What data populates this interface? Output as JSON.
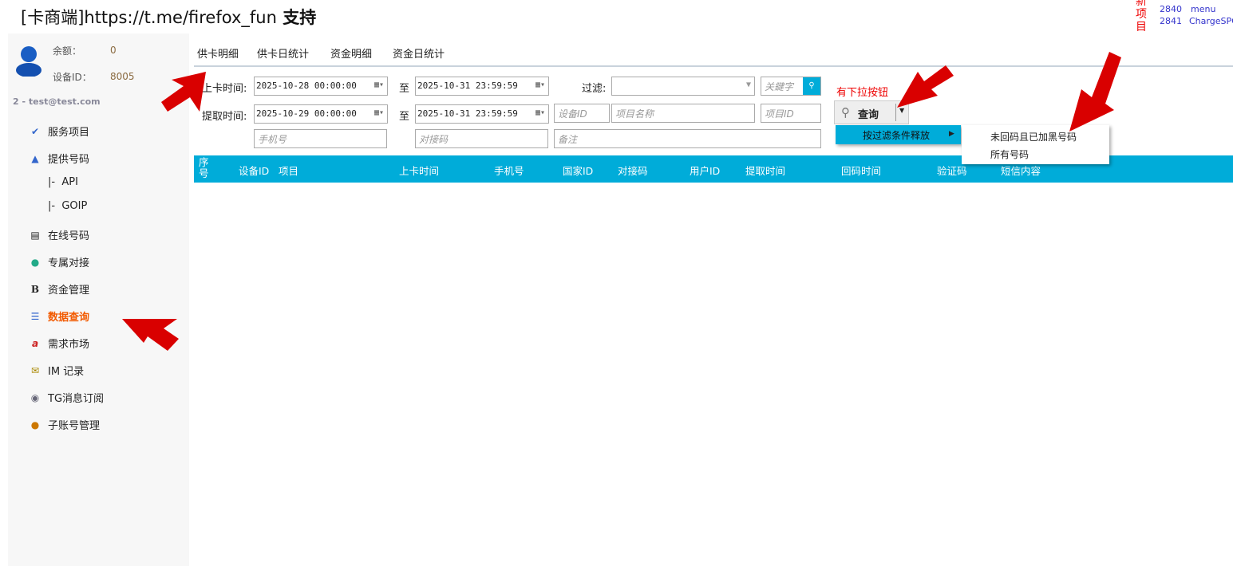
{
  "header": {
    "title_prefix": "[卡商端]",
    "title_url": "https://t.me/firefox_fun",
    "title_suffix": " 支持"
  },
  "new_projects": {
    "label": "新项目",
    "items": [
      {
        "id": "2840",
        "name": "menu"
      },
      {
        "id": "2841",
        "name": "ChargeSPC"
      }
    ]
  },
  "account": {
    "balance_label": "余额：",
    "balance": "0",
    "device_label": "设备ID：",
    "device_id": "8005",
    "user": "2 - test@test.com"
  },
  "sidebar": {
    "items": [
      {
        "label": "服务项目",
        "icon": "spellcheck-icon"
      },
      {
        "label": "提供号码",
        "icon": "arrow-up-icon"
      },
      {
        "label": "|-  API",
        "icon": ""
      },
      {
        "label": "|-  GOIP",
        "icon": ""
      },
      {
        "label": "在线号码",
        "icon": "list-box-icon"
      },
      {
        "label": "专属对接",
        "icon": "globe-link-icon"
      },
      {
        "label": "资金管理",
        "icon": "bold-b-icon"
      },
      {
        "label": "数据查询",
        "icon": "numbered-list-icon",
        "active": true
      },
      {
        "label": "需求市场",
        "icon": "document-a-icon"
      },
      {
        "label": "IM 记录",
        "icon": "envelope-icon"
      },
      {
        "label": "TG消息订阅",
        "icon": "speaker-icon"
      },
      {
        "label": "子账号管理",
        "icon": "user-search-icon"
      }
    ]
  },
  "tabs": [
    {
      "label": "供卡明细",
      "active": true
    },
    {
      "label": "供卡日统计"
    },
    {
      "label": "资金明细"
    },
    {
      "label": "资金日统计"
    }
  ],
  "filters": {
    "upload_time_label": "上卡时间:",
    "upload_from": "2025-10-28 00:00:00",
    "to_label": "至",
    "upload_to": "2025-10-31 23:59:59",
    "fetch_time_label": "提取时间:",
    "fetch_from": "2025-10-29 00:00:00",
    "fetch_to": "2025-10-31 23:59:59",
    "filter_label": "过滤:",
    "filter_value": "",
    "keyword_placeholder": "关鍵字",
    "device_placeholder": "设备ID",
    "project_name_placeholder": "项目名称",
    "project_id_placeholder": "项目ID",
    "phone_placeholder": "手机号",
    "code_placeholder": "对接码",
    "note_placeholder": "备注"
  },
  "query": {
    "annotation": "有下拉按钮",
    "button_label": "查询"
  },
  "dropdown": {
    "item": "按过滤条件释放",
    "submenu": [
      "未回码且已加黑号码",
      "所有号码"
    ]
  },
  "table": {
    "columns": [
      "序号",
      "设备ID",
      "项目",
      "上卡时间",
      "手机号",
      "国家ID",
      "对接码",
      "用户ID",
      "提取时间",
      "回码时间",
      "验证码",
      "短信内容"
    ]
  },
  "colors": {
    "accent": "#00acd9",
    "active_nav": "#f25a00",
    "arrow": "#d90000"
  }
}
